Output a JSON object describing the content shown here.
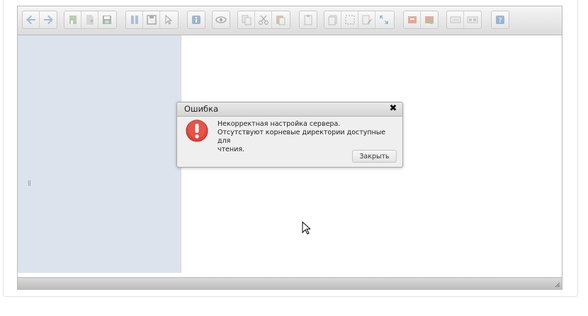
{
  "toolbar": {
    "groups": [
      [
        "back-icon",
        "forward-icon"
      ],
      [
        "home-icon",
        "new-file-icon",
        "save-disk-icon"
      ],
      [
        "book-icon",
        "floppy-icon",
        "pointer-icon"
      ],
      [
        "info-icon"
      ],
      [
        "eye-icon"
      ],
      [
        "copy-icon",
        "cut-icon",
        "paste-icon"
      ],
      [
        "clipboard-icon"
      ],
      [
        "duplicate-icon",
        "select-icon",
        "edit-icon",
        "resize-icon"
      ],
      [
        "archive-icon",
        "extract-icon"
      ],
      [
        "list-view-icon",
        "icon-view-icon"
      ],
      [
        "help-icon"
      ]
    ]
  },
  "dialog": {
    "title": "Ошибка",
    "close_glyph": "✖",
    "message_lines": [
      "Некорректная настройка сервера.",
      "Отсутствуют корневые директории доступные для",
      "чтения."
    ],
    "button_label": "Закрыть"
  },
  "colors": {
    "tree_bg": "#dce3ec",
    "error_red": "#e0433a"
  }
}
